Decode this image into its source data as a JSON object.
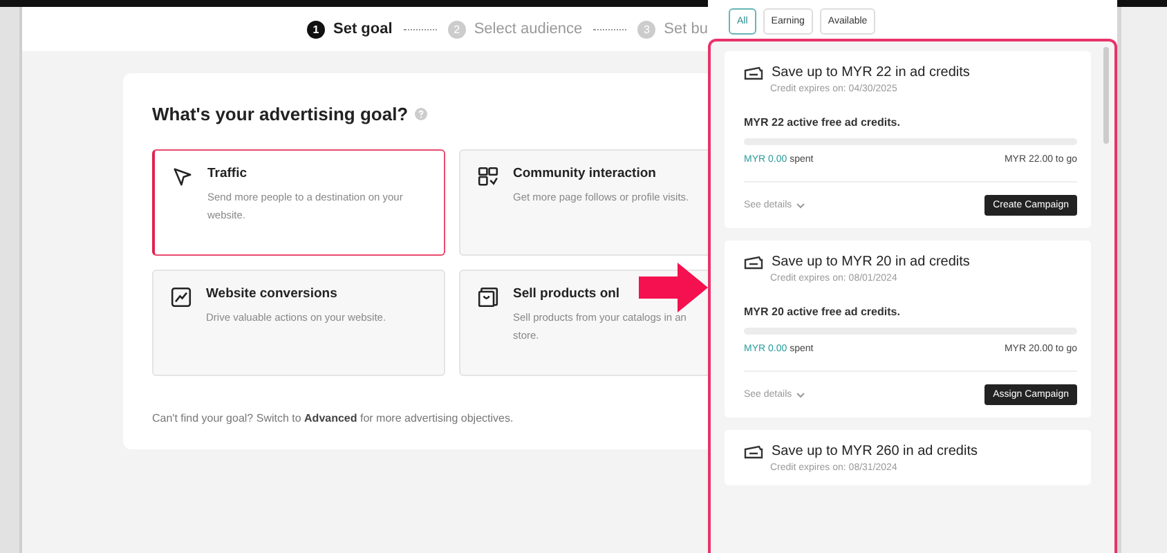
{
  "steps": [
    {
      "number": "1",
      "label": "Set goal",
      "selected": true
    },
    {
      "number": "2",
      "label": "Select audience",
      "selected": false
    },
    {
      "number": "3",
      "label": "Set bu",
      "selected": false
    }
  ],
  "goal": {
    "title": "What's your advertising goal?",
    "options": [
      {
        "kind": "cursor",
        "title": "Traffic",
        "lines": [
          "Send more people to a destination on your",
          "website."
        ],
        "selected": true
      },
      {
        "kind": "community",
        "title": "Community interaction",
        "lines": [
          "Get more page follows or profile visits."
        ],
        "selected": false
      },
      {
        "kind": "chart",
        "title": "Website conversions",
        "lines": [
          "Drive valuable actions on your website."
        ],
        "selected": false
      },
      {
        "kind": "shop",
        "title": "Sell products onl",
        "lines": [
          "Sell products from your catalogs in an",
          "store."
        ],
        "selected": false
      }
    ],
    "footer": "Can't find your goal? Switch to **Advanced** for more advertising objectives."
  },
  "filters": [
    {
      "label": "All",
      "selected": true
    },
    {
      "label": "Earning",
      "selected": false
    },
    {
      "label": "Available",
      "selected": false
    }
  ],
  "credits": [
    {
      "title": "Save up to MYR 22 in ad credits",
      "expires": "Credit expires on: 04/30/2025",
      "summary": "MYR 22 active free ad credits.",
      "level": 0,
      "spent": "MYR 0.00",
      "spent_label": "spent",
      "to_go": "MYR 22.00 to go",
      "details": "See details",
      "action": "Create Campaign"
    },
    {
      "title": "Save up to MYR 20 in ad credits",
      "expires": "Credit expires on: 08/01/2024",
      "summary": "MYR 20 active free ad credits.",
      "level": 0,
      "spent": "MYR 0.00",
      "spent_label": "spent",
      "to_go": "MYR 20.00 to go",
      "details": "See details",
      "action": "Assign Campaign"
    },
    {
      "title": "Save up to MYR 260 in ad credits",
      "expires": "Credit expires on: 08/31/2024"
    }
  ]
}
